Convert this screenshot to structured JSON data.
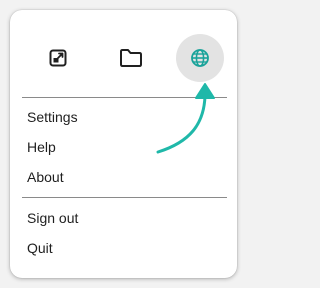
{
  "menu": {
    "icons": [
      {
        "name": "open-in-window-icon",
        "state": "normal"
      },
      {
        "name": "folder-icon",
        "state": "normal"
      },
      {
        "name": "globe-icon",
        "state": "highlighted",
        "color": "#1aa39a"
      }
    ],
    "items_group1": [
      "Settings",
      "Help",
      "About"
    ],
    "items_group2": [
      "Sign out",
      "Quit"
    ]
  },
  "annotation": {
    "type": "curved-arrow",
    "target": "globe-icon",
    "color": "#1fb8a9"
  },
  "colors": {
    "highlight_bg": "#e3e3e3",
    "text": "#1f1f1f",
    "accent": "#1aa39a"
  }
}
